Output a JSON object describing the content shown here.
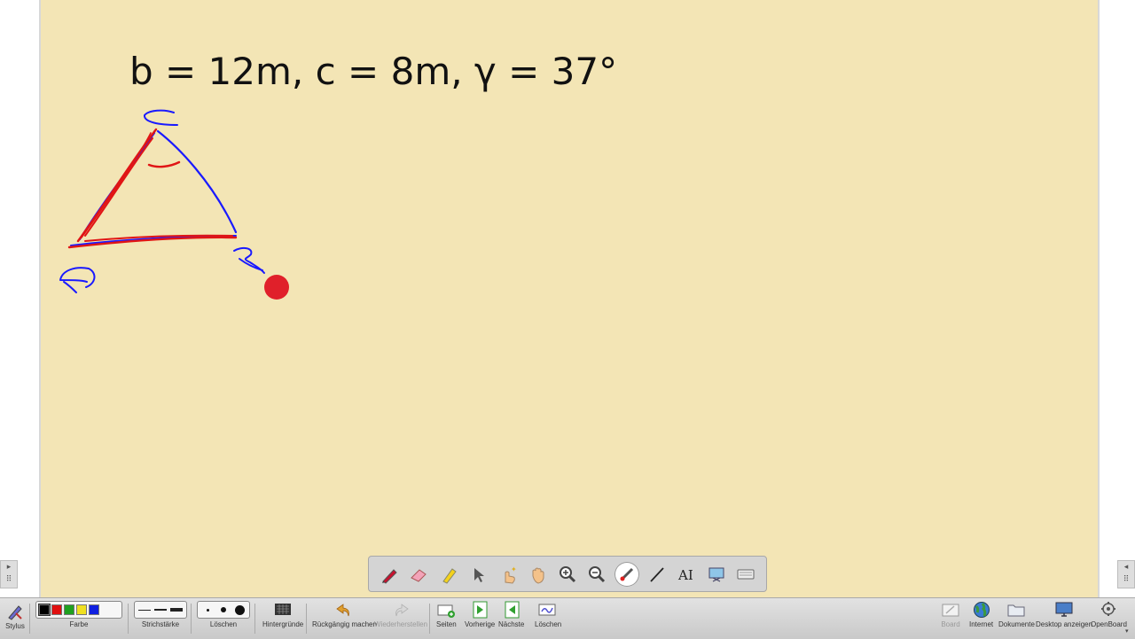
{
  "board": {
    "formula": "b = 12m, c = 8m, γ = 37°",
    "background_color": "#f3e5b5",
    "ink_colors": {
      "blue": "#1a1aff",
      "red": "#e01515",
      "pointer": "#e0202a"
    }
  },
  "floating_toolbar": {
    "tools": [
      {
        "icon": "pen-icon"
      },
      {
        "icon": "eraser-icon"
      },
      {
        "icon": "highlighter-icon"
      },
      {
        "icon": "pointer-icon"
      },
      {
        "icon": "interact-icon"
      },
      {
        "icon": "hand-icon"
      },
      {
        "icon": "zoom-in-icon"
      },
      {
        "icon": "zoom-out-icon"
      },
      {
        "icon": "laser-pointer-icon"
      },
      {
        "icon": "line-icon"
      },
      {
        "icon": "text-icon"
      },
      {
        "icon": "capture-icon"
      },
      {
        "icon": "keyboard-icon"
      }
    ]
  },
  "bottom_bar": {
    "stylus_label": "Stylus",
    "color_label": "Farbe",
    "colors": [
      "#000000",
      "#e01010",
      "#20a020",
      "#f0e020",
      "#1020e0"
    ],
    "stroke_label": "Strichstärke",
    "erase_label": "Löschen",
    "backgrounds_label": "Hintergründe",
    "undo_label": "Rückgängig machen",
    "redo_label": "Wiederherstellen",
    "pages_label": "Seiten",
    "previous_label": "Vorherige",
    "next_label": "Nächste",
    "clear_label": "Löschen",
    "board_label": "Board",
    "internet_label": "Internet",
    "documents_label": "Dokumente",
    "desktop_label": "Desktop anzeigen",
    "openboard_label": "OpenBoard"
  }
}
